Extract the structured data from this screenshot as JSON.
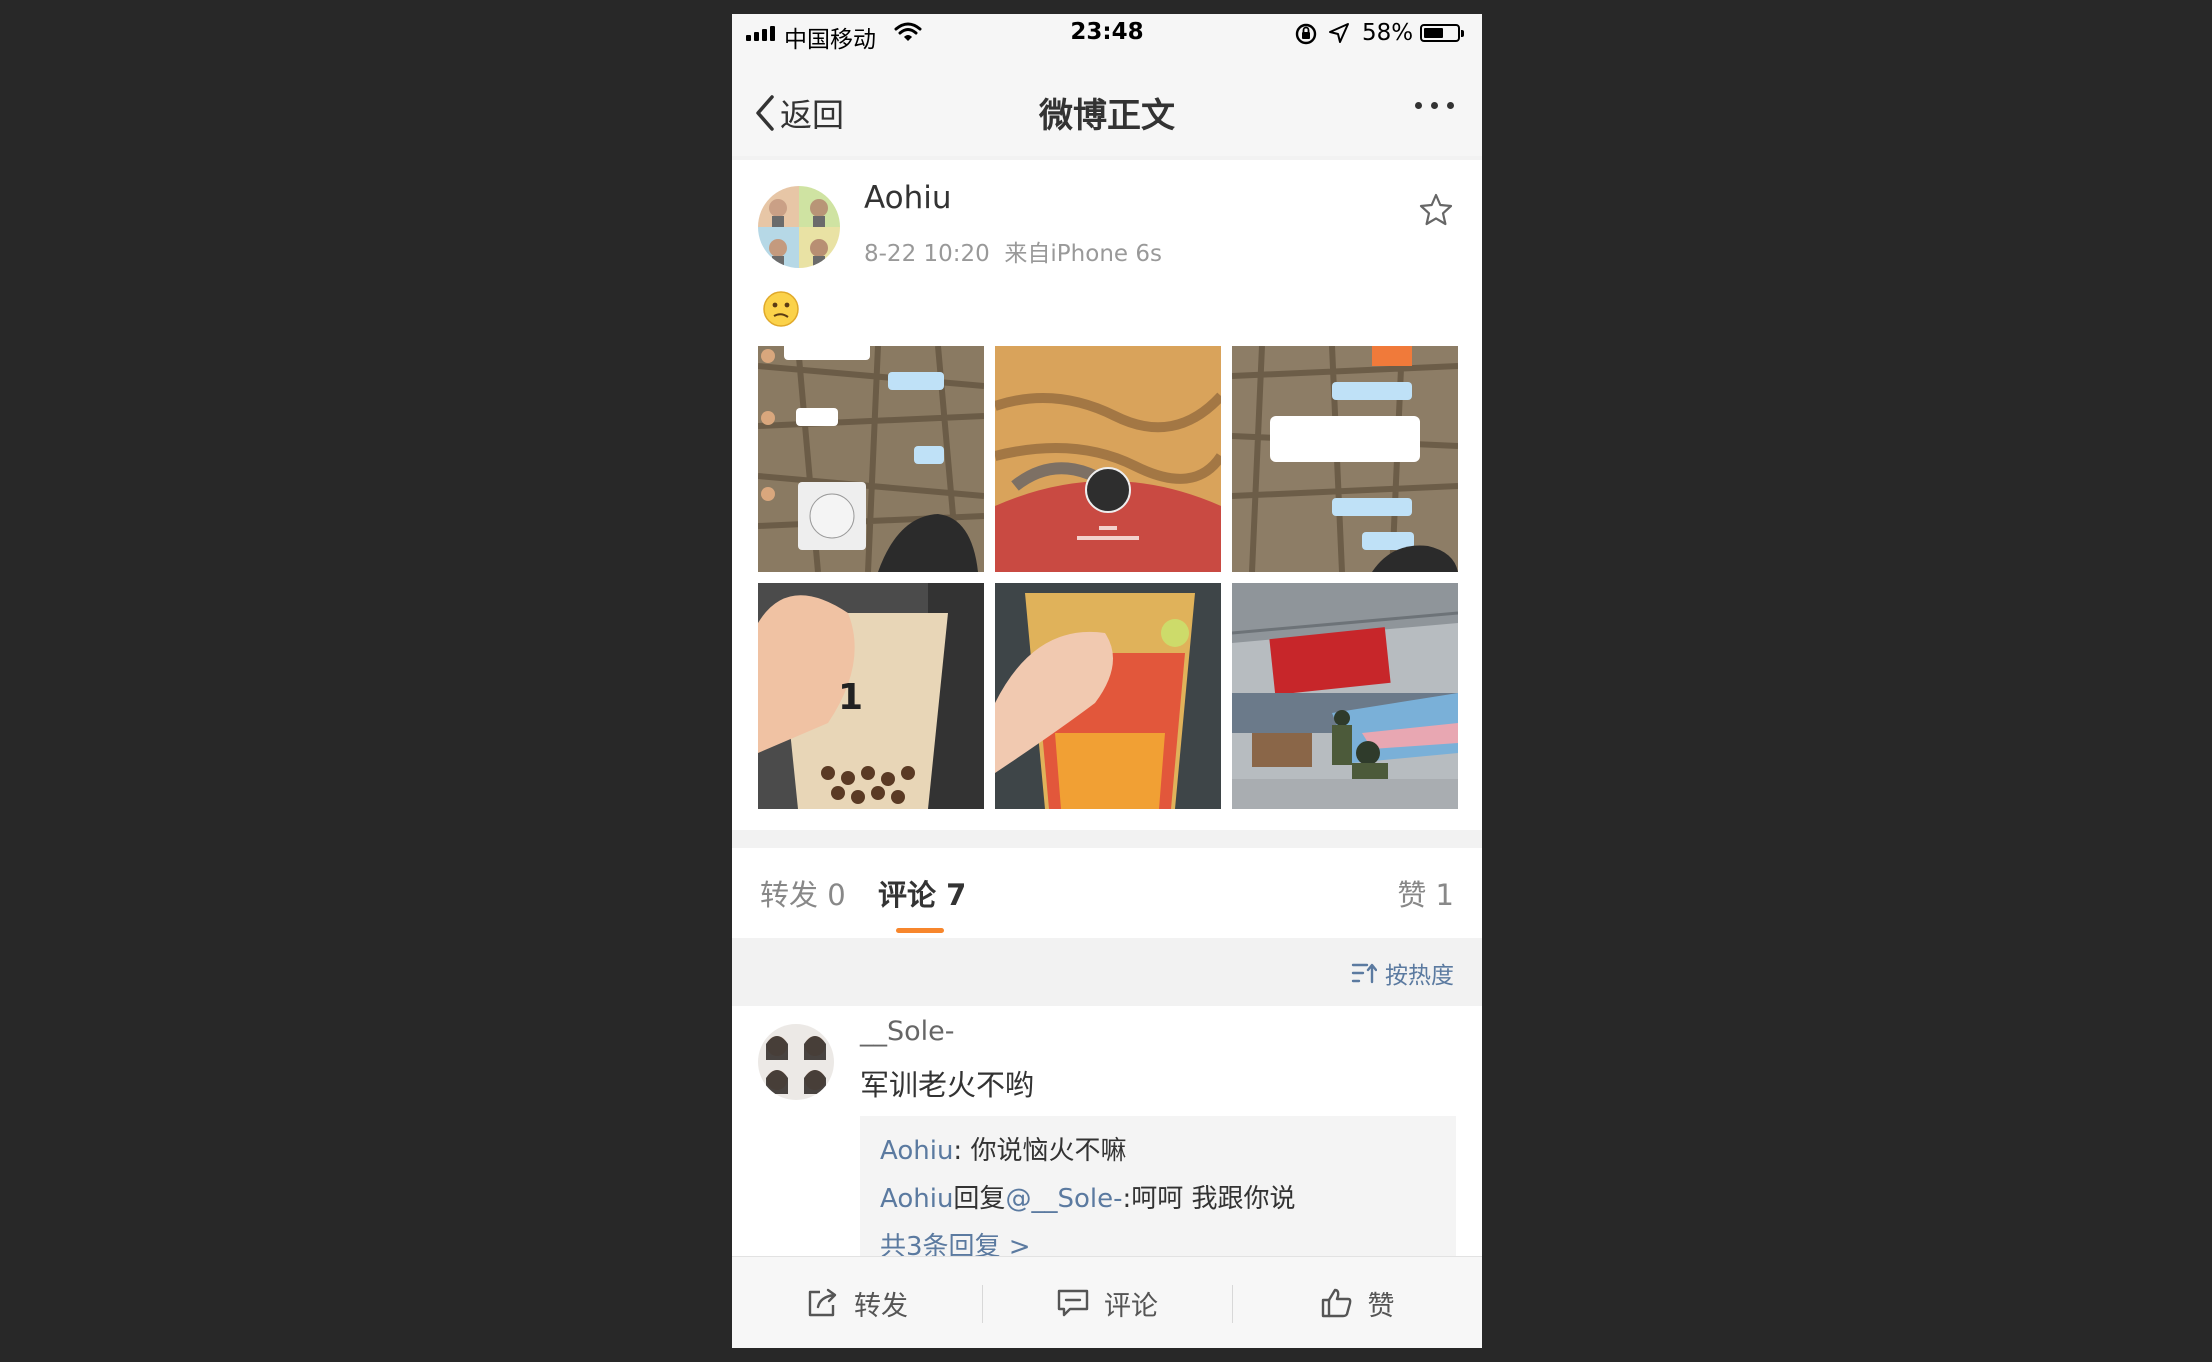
{
  "status": {
    "carrier": "中国移动",
    "time": "23:48",
    "battery": "58%",
    "battery_level": 0.58
  },
  "nav": {
    "back_label": "返回",
    "title": "微博正文"
  },
  "post": {
    "author": "Aohiu",
    "time": "8-22 10:20",
    "source": "来自iPhone 6s",
    "image_count": 6
  },
  "tabs": {
    "repost": "转发 0",
    "comment": "评论 7",
    "likes": "赞 1"
  },
  "sort": {
    "label": "按热度"
  },
  "comment": {
    "user": "__Sole-",
    "text": "军训老火不哟",
    "reply1_user": "Aohiu",
    "reply1_text": ": 你说恼火不嘛",
    "reply2_user": "Aohiu",
    "reply2_verb": "回复",
    "reply2_mention": "@__Sole-",
    "reply2_text": ":呵呵 我跟你说",
    "more_replies": "共3条回复 >"
  },
  "toolbar": {
    "repost": "转发",
    "comment": "评论",
    "like": "赞"
  },
  "colors": {
    "accent": "#f7862c",
    "link": "#5b7aa0"
  }
}
